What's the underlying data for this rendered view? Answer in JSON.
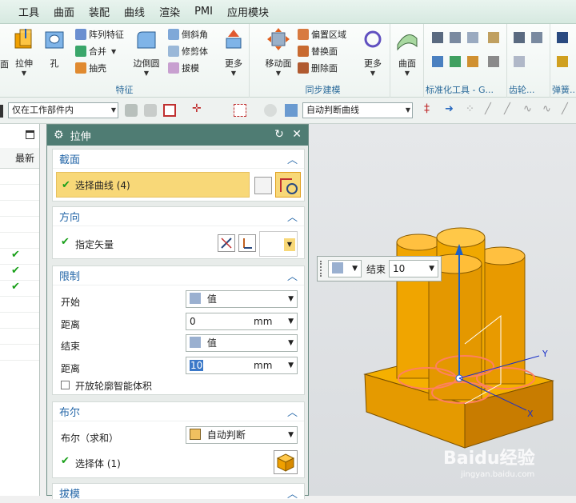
{
  "menu": [
    "工具",
    "曲面",
    "装配",
    "曲线",
    "渲染",
    "PMI",
    "应用模块"
  ],
  "ribbon": {
    "feature_group": {
      "title": "特征",
      "big": [
        {
          "label": "拉伸",
          "icon": "extrude-icon"
        },
        {
          "label": "孔",
          "icon": "hole-icon"
        },
        {
          "label": "边倒圆",
          "icon": "edge-blend-icon"
        },
        {
          "label": "更多",
          "icon": "more-icon"
        }
      ],
      "small": [
        {
          "label": "阵列特征",
          "icon": "pattern-icon"
        },
        {
          "label": "合并",
          "icon": "unite-icon"
        },
        {
          "label": "抽壳",
          "icon": "shell-icon"
        },
        {
          "label": "倒斜角",
          "icon": "chamfer-icon"
        },
        {
          "label": "修剪体",
          "icon": "trim-body-icon"
        },
        {
          "label": "拔模",
          "icon": "draft-icon"
        }
      ],
      "left_cut": "面"
    },
    "sync_group": {
      "title": "同步建模",
      "big": [
        {
          "label": "移动面",
          "icon": "move-face-icon"
        },
        {
          "label": "更多",
          "icon": "more-icon"
        }
      ],
      "small": [
        {
          "label": "偏置区域",
          "icon": "offset-region-icon"
        },
        {
          "label": "替换面",
          "icon": "replace-face-icon"
        },
        {
          "label": "删除面",
          "icon": "delete-face-icon"
        }
      ]
    },
    "surface_group": {
      "big": {
        "label": "曲面",
        "icon": "surface-icon"
      }
    },
    "std_group": {
      "title": "标准化工具 - G..."
    },
    "gear_group": {
      "title": "齿轮..."
    },
    "spring_group": {
      "title": "弹簧..."
    }
  },
  "selection_bar": {
    "scope_value": "仅在工作部件内",
    "curve_rule_value": "自动判断曲线"
  },
  "left_pane": {
    "header": "最新",
    "checks": [
      "✔",
      "✔",
      "✔"
    ]
  },
  "dialog": {
    "title": "拉伸",
    "section": {
      "title": "截面",
      "select_curve": "选择曲线 (4)"
    },
    "direction": {
      "title": "方向",
      "vector_label": "指定矢量"
    },
    "limits": {
      "title": "限制",
      "start_label": "开始",
      "start_value": "值",
      "distance1_label": "距离",
      "distance1_value": "0",
      "unit1": "mm",
      "end_label": "结束",
      "end_value": "值",
      "distance2_label": "距离",
      "distance2_value": "10",
      "unit2": "mm",
      "open_profile_label": "开放轮廓智能体积"
    },
    "boolean": {
      "title": "布尔",
      "label": "布尔（求和）",
      "value": "自动判断",
      "select_body": "选择体 (1)"
    },
    "draft": {
      "title": "拔模"
    }
  },
  "viewport": {
    "float_end_label": "结束",
    "float_end_value": "10",
    "axis_y": "Y",
    "axis_x": "X",
    "watermark_brand": "Baidu经验",
    "watermark_url": "jingyan.baidu.com"
  },
  "colors": {
    "accent": "#2567a8",
    "title_bar": "#4f7c73",
    "model_orange": "#f0a000",
    "check_green": "#1aa01a",
    "selection_yellow": "#f8d878"
  }
}
